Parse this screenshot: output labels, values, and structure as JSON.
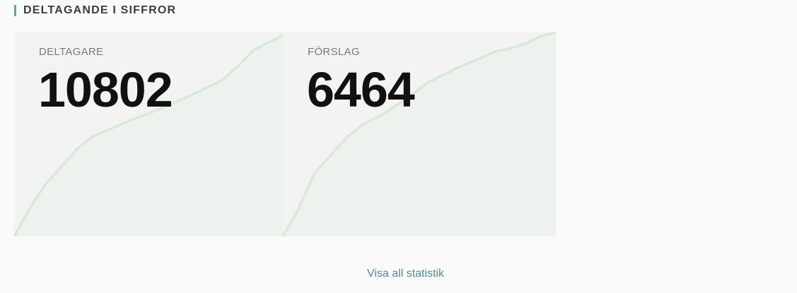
{
  "section": {
    "title": "DELTAGANDE I SIFFROR"
  },
  "stats": [
    {
      "label": "DELTAGARE",
      "value": "10802"
    },
    {
      "label": "FÖRSLAG",
      "value": "6464"
    }
  ],
  "footer": {
    "link_label": "Visa all statistik"
  },
  "colors": {
    "accent": "#5fb167",
    "card_bg": "#f3f3f3",
    "chart_fill": "#e8f1e9",
    "chart_line": "#d3e9d5",
    "link": "#4f8a96"
  }
}
